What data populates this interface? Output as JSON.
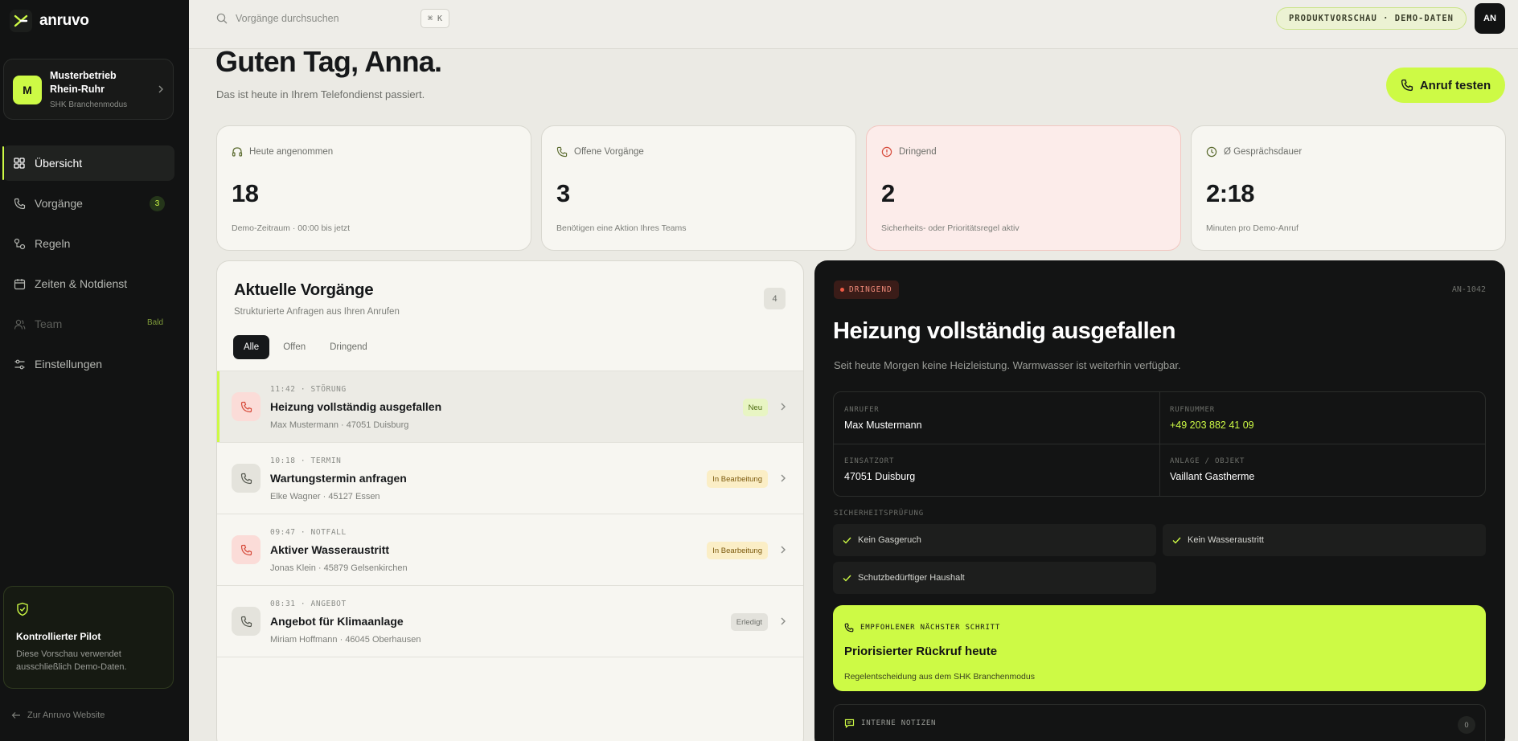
{
  "brand": {
    "name": "anruvo",
    "accent": "#cdfa45"
  },
  "org": {
    "avatar": "M",
    "name": "Musterbetrieb Rhein-Ruhr",
    "mode": "SHK Branchenmodus"
  },
  "nav": [
    {
      "label": "Übersicht",
      "icon": "grid-icon"
    },
    {
      "label": "Vorgänge",
      "icon": "phone-icon",
      "badge": "3"
    },
    {
      "label": "Regeln",
      "icon": "rules-icon"
    },
    {
      "label": "Zeiten & Notdienst",
      "icon": "calendar-icon"
    },
    {
      "label": "Team",
      "icon": "users-icon",
      "tag": "Bald"
    },
    {
      "label": "Einstellungen",
      "icon": "sliders-icon"
    }
  ],
  "pilot": {
    "title": "Kontrollierter Pilot",
    "text": "Diese Vorschau verwendet ausschließlich Demo-Daten."
  },
  "back_link": "Zur Anruvo Website",
  "topbar": {
    "search_placeholder": "Vorgänge durchsuchen",
    "shortcut": "⌘ K",
    "preview": "PRODUKTVORSCHAU · DEMO-DATEN",
    "avatar": "AN"
  },
  "greeting": {
    "title": "Guten Tag, Anna.",
    "subtitle": "Das ist heute in Ihrem Telefondienst passiert.",
    "cta": "Anruf testen"
  },
  "stats": [
    {
      "label": "Heute angenommen",
      "value": "18",
      "sub": "Demo-Zeitraum · 00:00 bis jetzt"
    },
    {
      "label": "Offene Vorgänge",
      "value": "3",
      "sub": "Benötigen eine Aktion Ihres Teams"
    },
    {
      "label": "Dringend",
      "value": "2",
      "sub": "Sicherheits- oder Prioritätsregel aktiv"
    },
    {
      "label": "Ø Gesprächsdauer",
      "value": "2:18",
      "sub": "Minuten pro Demo-Anruf"
    }
  ],
  "list": {
    "title": "Aktuelle Vorgänge",
    "subtitle": "Strukturierte Anfragen aus Ihren Anrufen",
    "count": "4",
    "filters": [
      "Alle",
      "Offen",
      "Dringend"
    ],
    "rows": [
      {
        "meta": "11:42 · STÖRUNG",
        "title": "Heizung vollständig ausgefallen",
        "sub": "Max Mustermann · 47051 Duisburg",
        "badge": "Neu"
      },
      {
        "meta": "10:18 · TERMIN",
        "title": "Wartungstermin anfragen",
        "sub": "Elke Wagner · 45127 Essen",
        "badge": "In Bearbeitung"
      },
      {
        "meta": "09:47 · NOTFALL",
        "title": "Aktiver Wasseraustritt",
        "sub": "Jonas Klein · 45879 Gelsenkirchen",
        "badge": "In Bearbeitung"
      },
      {
        "meta": "08:31 · ANGEBOT",
        "title": "Angebot für Klimaanlage",
        "sub": "Miriam Hoffmann · 46045 Oberhausen",
        "badge": "Erledigt"
      }
    ]
  },
  "detail": {
    "tag": "DRINGEND",
    "id": "AN-1042",
    "title": "Heizung vollständig ausgefallen",
    "subtitle": "Seit heute Morgen keine Heizleistung. Warmwasser ist weiterhin verfügbar.",
    "fields": {
      "caller_k": "ANRUFER",
      "caller_v": "Max Mustermann",
      "phone_k": "RUFNUMMER",
      "phone_v": "+49 203 882 41 09",
      "site_k": "EINSATZORT",
      "site_v": "47051 Duisburg",
      "system_k": "ANLAGE / OBJEKT",
      "system_v": "Vaillant Gastherme"
    },
    "safety_label": "SICHERHEITSPRÜFUNG",
    "checks": [
      "Kein Gasgeruch",
      "Kein Wasseraustritt",
      "Schutzbedürftiger Haushalt"
    ],
    "next": {
      "label": "EMPFOHLENER NÄCHSTER SCHRITT",
      "title": "Priorisierter Rückruf heute",
      "sub": "Regelentscheidung aus dem SHK Branchenmodus"
    },
    "notes": {
      "label": "INTERNE NOTIZEN",
      "count": "0"
    }
  }
}
